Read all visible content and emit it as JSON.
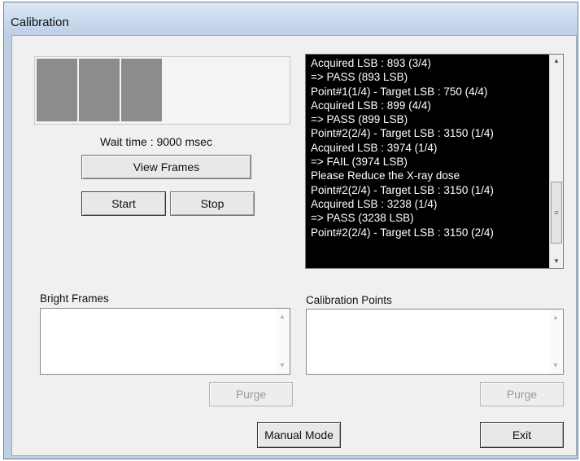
{
  "window": {
    "title": "Calibration"
  },
  "preview": {
    "wait_time": "Wait time : 9000 msec"
  },
  "buttons": {
    "view_frames": "View Frames",
    "start": "Start",
    "stop": "Stop",
    "purge": "Purge",
    "manual_mode": "Manual Mode",
    "exit": "Exit"
  },
  "log": {
    "lines": [
      "Acquired LSB : 893 (3/4)",
      " => PASS (893 LSB)",
      "Point#1(1/4) - Target LSB : 750 (4/4)",
      "Acquired LSB : 899 (4/4)",
      " => PASS (899 LSB)",
      "Point#2(2/4) - Target LSB : 3150 (1/4)",
      "Acquired LSB : 3974 (1/4)",
      " => FAIL (3974 LSB)",
      "Please Reduce the X-ray dose",
      "Point#2(2/4) - Target LSB : 3150 (1/4)",
      "Acquired LSB : 3238 (1/4)",
      " => PASS (3238 LSB)",
      "Point#2(2/4) - Target LSB : 3150 (2/4)"
    ]
  },
  "bright_frames": {
    "label": "Bright Frames",
    "items": []
  },
  "calibration_points": {
    "label": "Calibration Points",
    "items": []
  },
  "icons": {
    "scroll_up": "up-arrow-icon",
    "scroll_down": "down-arrow-icon",
    "grip": "scroll-grip-icon"
  }
}
